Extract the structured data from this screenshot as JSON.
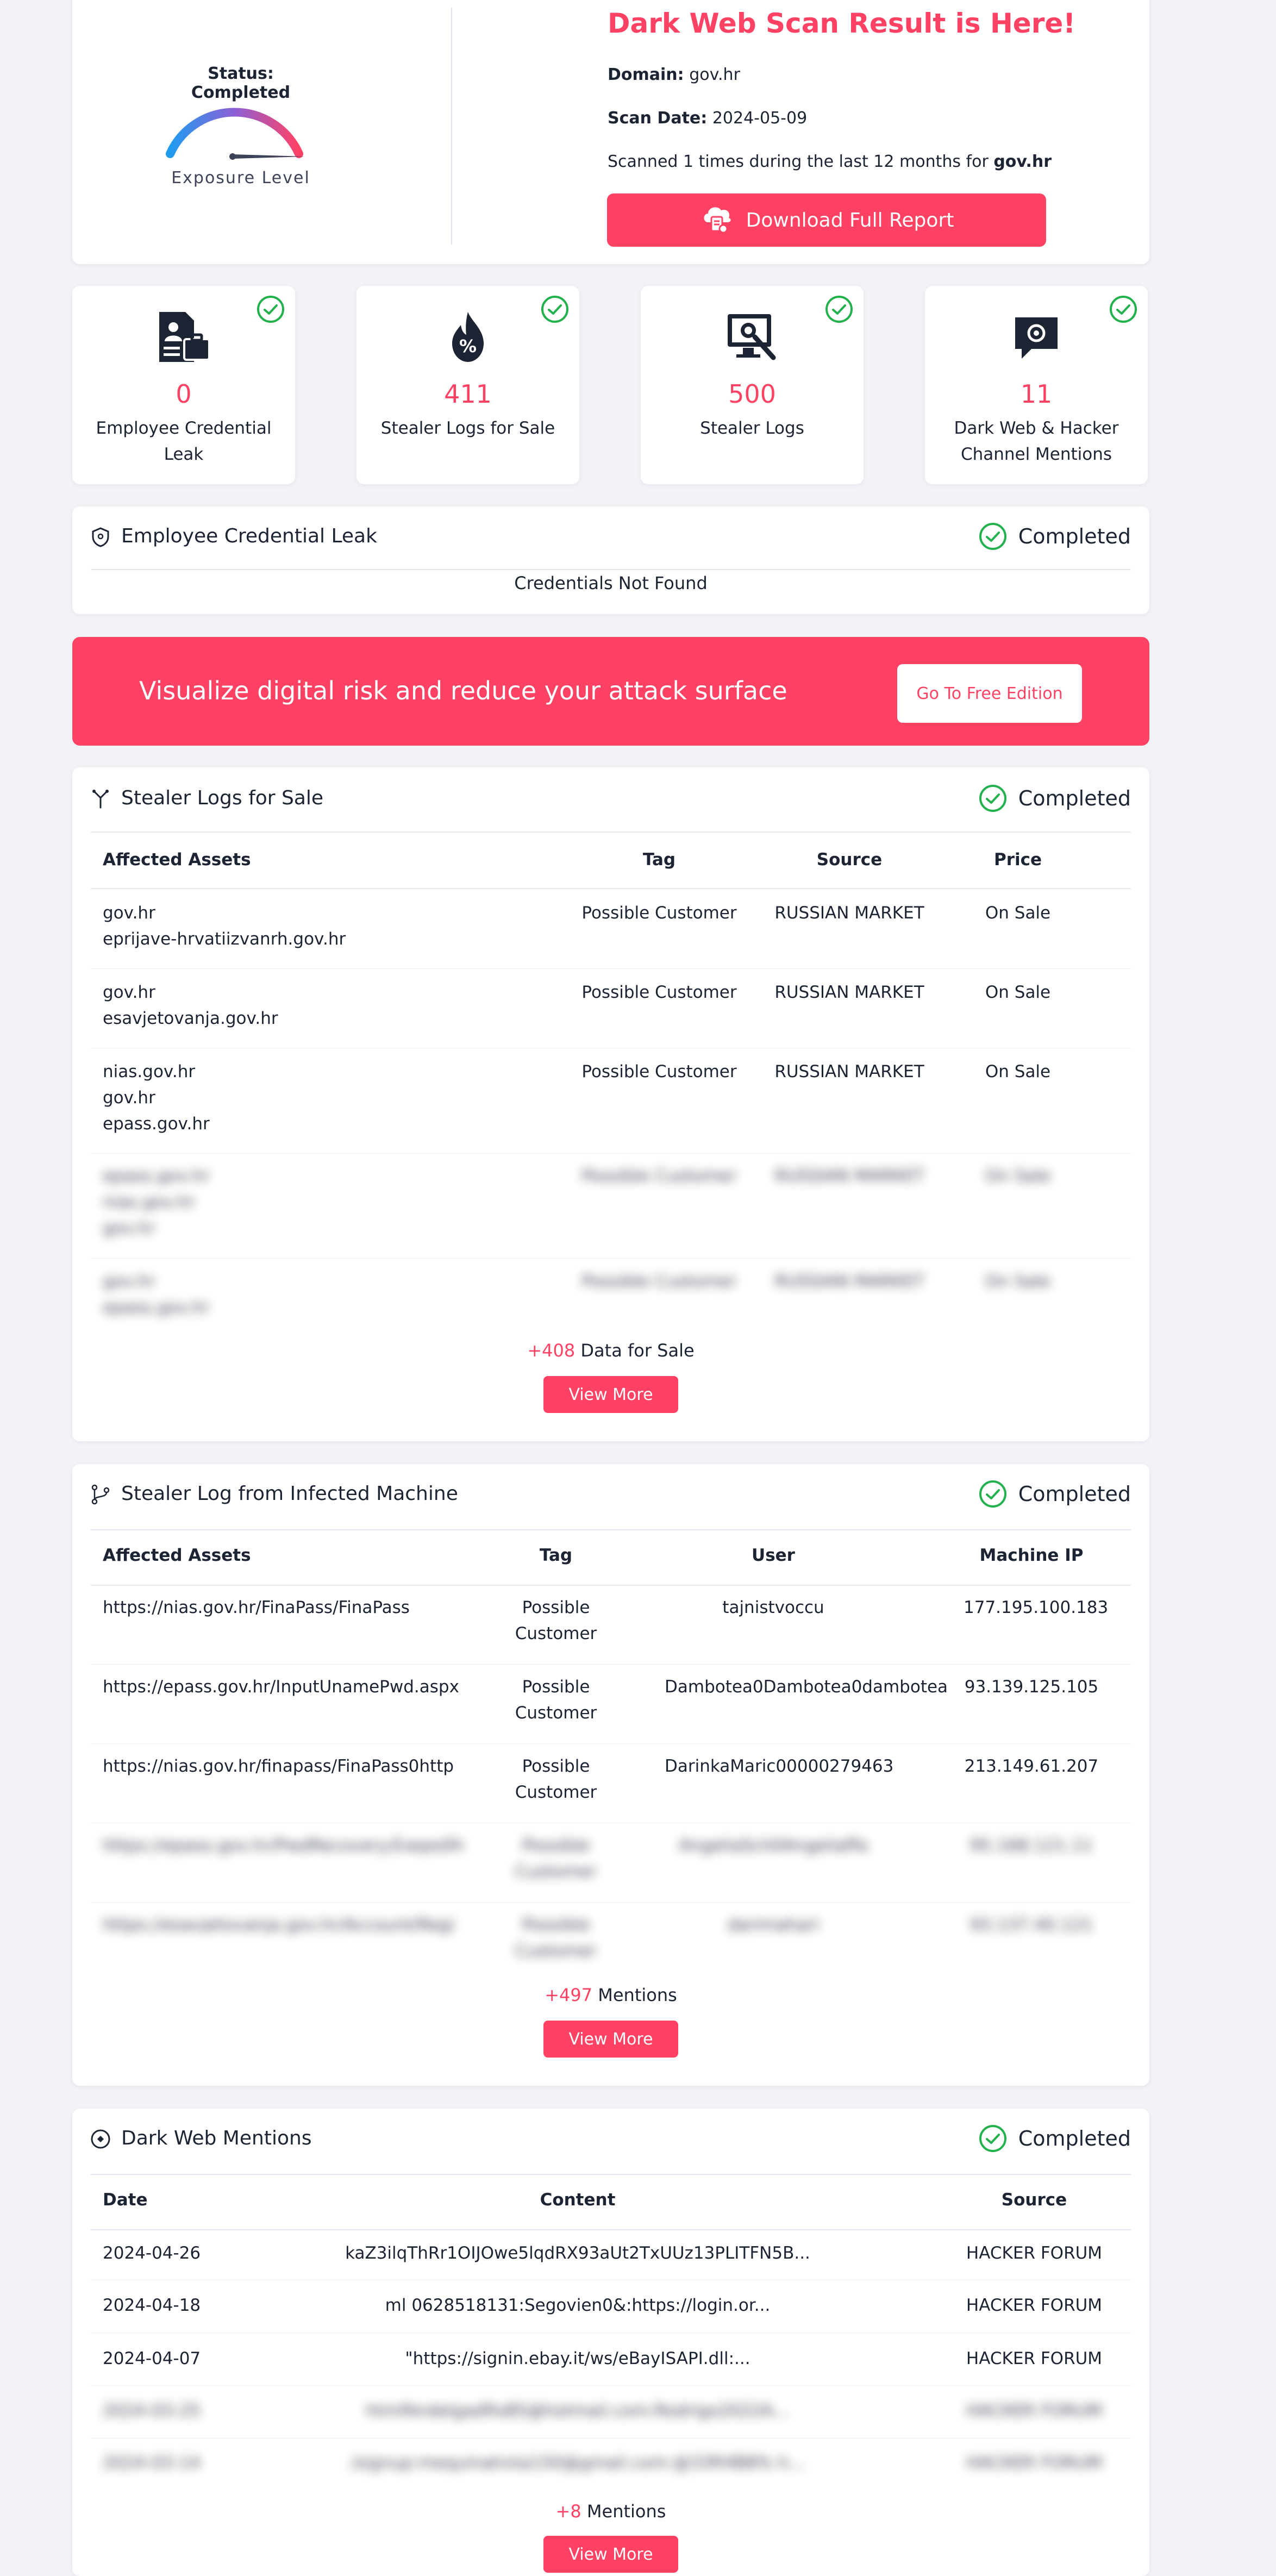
{
  "header": {
    "status": "Status: Completed",
    "exposure_label": "Exposure Level",
    "title": "Dark Web Scan Result is Here!",
    "domain_key": "Domain:",
    "domain_val": "gov.hr",
    "date_key": "Scan Date:",
    "date_val": "2024-05-09",
    "scanned_prefix": "Scanned 1 times during the last 12 months for ",
    "scanned_domain": "gov.hr",
    "download_label": "Download Full Report"
  },
  "stats": [
    {
      "value": "0",
      "label": "Employee Credential Leak",
      "icon": "employee-briefcase-icon"
    },
    {
      "value": "411",
      "label": "Stealer Logs for Sale",
      "icon": "percent-flame-icon"
    },
    {
      "value": "500",
      "label": "Stealer Logs",
      "icon": "monitor-virus-icon"
    },
    {
      "value": "11",
      "label": "Dark Web & Hacker Channel Mentions",
      "icon": "chat-bubble-icon"
    }
  ],
  "credential_leak": {
    "title": "Employee Credential Leak",
    "status": "Completed",
    "message": "Credentials Not Found"
  },
  "banner": {
    "text": "Visualize digital risk and reduce your attack surface",
    "button": "Go To Free Edition"
  },
  "stealer_sale": {
    "title": "Stealer Logs for Sale",
    "status": "Completed",
    "headers": [
      "Affected Assets",
      "Tag",
      "Source",
      "Price"
    ],
    "rows": [
      {
        "assets": [
          "gov.hr",
          "eprijave-hrvatiizvanrh.gov.hr"
        ],
        "tag": "Possible Customer",
        "source": "RUSSIAN MARKET",
        "price": "On Sale"
      },
      {
        "assets": [
          "gov.hr",
          "esavjetovanja.gov.hr"
        ],
        "tag": "Possible Customer",
        "source": "RUSSIAN MARKET",
        "price": "On Sale"
      },
      {
        "assets": [
          "nias.gov.hr",
          "gov.hr",
          "epass.gov.hr"
        ],
        "tag": "Possible Customer",
        "source": "RUSSIAN MARKET",
        "price": "On Sale"
      },
      {
        "assets": [
          "epass.gov.hr",
          "nias.gov.hr",
          "gov.hr"
        ],
        "tag": "Possible Customer",
        "source": "RUSSIAN MARKET",
        "price": "On Sale"
      },
      {
        "assets": [
          "gov.hr",
          "epass.gov.hr"
        ],
        "tag": "Possible Customer",
        "source": "RUSSIAN MARKET",
        "price": "On Sale"
      }
    ],
    "more_count": "+408",
    "more_text": " Data for Sale",
    "view_more": "View More"
  },
  "stealer_machine": {
    "title": "Stealer Log from Infected Machine",
    "status": "Completed",
    "headers": [
      "Affected Assets",
      "Tag",
      "User",
      "Machine IP"
    ],
    "rows": [
      {
        "asset": "https://nias.gov.hr/FinaPass/FinaPass",
        "tag": [
          "Possible",
          "Customer"
        ],
        "user": "tajnistvoccu",
        "ip": "177.195.100.183"
      },
      {
        "asset": "https://epass.gov.hr/InputUnamePwd.aspx",
        "tag": [
          "Possible",
          "Customer"
        ],
        "user": "Dambotea0Dambotea0dambotea",
        "ip": "93.139.125.105"
      },
      {
        "asset": "https://nias.gov.hr/finapass/FinaPass0http",
        "tag": [
          "Possible",
          "Customer"
        ],
        "user": "DarinkaMaric00000279463",
        "ip": "213.149.61.207"
      },
      {
        "asset": "https://epass.gov.hr/PwdRecovery.Exepo0h",
        "tag": [
          "Possible",
          "Customer"
        ],
        "user": "AngeliaSch0Angeliaffa",
        "ip": "95.168.121.11"
      },
      {
        "asset": "https://esavjetovanja.gov.hr/Account/Regi",
        "tag": [
          "Possible",
          "Customer"
        ],
        "user": "darimahari",
        "ip": "93.137.40.121"
      }
    ],
    "more_count": "+497",
    "more_text": " Mentions",
    "view_more": "View More"
  },
  "dark_mentions": {
    "title": "Dark Web Mentions",
    "status": "Completed",
    "headers": [
      "Date",
      "Content",
      "Source"
    ],
    "rows": [
      {
        "date": "2024-04-26",
        "content": "kaZ3ilqThRr1OIJOwe5lqdRX93aUt2TxUUz13PLITFN5B...",
        "source": "HACKER FORUM"
      },
      {
        "date": "2024-04-18",
        "content": "ml 0628518131:Segovien0&:https://login.or...",
        "source": "HACKER FORUM"
      },
      {
        "date": "2024-04-07",
        "content": "\"https://signin.ebay.it/ws/eBayISAPI.dll:...",
        "source": "HACKER FORUM"
      },
      {
        "date": "2024-03-25",
        "content": "htmlferdelgadfio85@hotmail.com:Rodrigo2022A...",
        "source": "HACKER FORUM"
      },
      {
        "date": "2024-03-14",
        "content": "/signup:mequinatroia150@gmail.com:@33ft4B8% h...",
        "source": "HACKER FORUM"
      }
    ],
    "more_count": "+8",
    "more_text": " Mentions",
    "view_more": "View More"
  },
  "colors": {
    "accent": "#ff4264",
    "success": "#22b14c",
    "text": "#1c2333",
    "background": "#f2f3f7"
  }
}
